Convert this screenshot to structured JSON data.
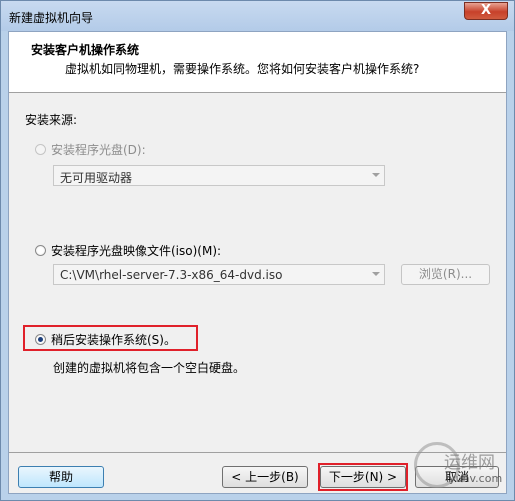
{
  "window": {
    "title": "新建虚拟机向导",
    "close_glyph": "X"
  },
  "header": {
    "title": "安装客户机操作系统",
    "subtitle": "虚拟机如同物理机，需要操作系统。您将如何安装客户机操作系统?"
  },
  "source": {
    "section_label": "安装来源:",
    "disc": {
      "label": "安装程序光盘(D):",
      "selected": false,
      "enabled": false,
      "drive_value": "无可用驱动器"
    },
    "iso": {
      "label": "安装程序光盘映像文件(iso)(M):",
      "selected": false,
      "path_value": "C:\\VM\\rhel-server-7.3-x86_64-dvd.iso",
      "browse_label": "浏览(R)..."
    },
    "later": {
      "label": "稍后安装操作系统(S)。",
      "selected": true,
      "description": "创建的虚拟机将包含一个空白硬盘。"
    }
  },
  "footer": {
    "help_label": "帮助",
    "back_label": "< 上一步(B)",
    "next_label": "下一步(N) >",
    "cancel_label": "取消"
  },
  "watermark": {
    "cn": "运维网",
    "en": "iyunv.com"
  },
  "colors": {
    "highlight": "#e0202a",
    "radio_dot": "#1d3f7c"
  }
}
